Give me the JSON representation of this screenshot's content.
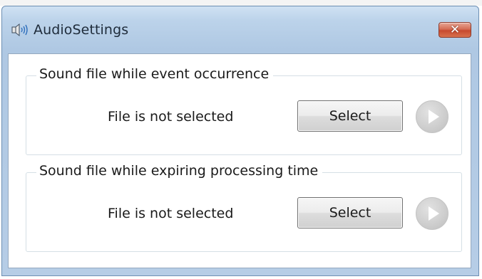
{
  "window": {
    "title": "AudioSettings",
    "close_symbol": "✕",
    "icon": "speaker-icon",
    "title_bar_color": "#bcd3ea",
    "close_color": "#c74a2f"
  },
  "groups": [
    {
      "title": "Sound file while event occurrence",
      "status": "File is not selected",
      "select_label": "Select",
      "play_icon": "play-icon"
    },
    {
      "title": "Sound file while expiring processing time",
      "status": "File is not selected",
      "select_label": "Select",
      "play_icon": "play-icon"
    }
  ]
}
